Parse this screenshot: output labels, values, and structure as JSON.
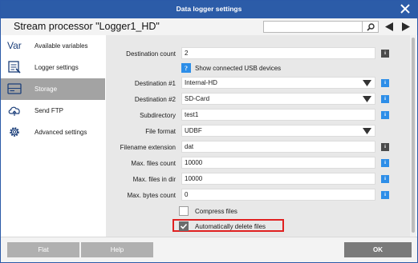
{
  "window": {
    "title": "Data logger settings"
  },
  "header": {
    "processor_title": "Stream processor \"Logger1_HD\"",
    "search_value": ""
  },
  "sidebar": {
    "items": [
      {
        "icon_text": "Var",
        "label": "Available variables",
        "active": false
      },
      {
        "label": "Logger settings",
        "active": false
      },
      {
        "label": "Storage",
        "active": true
      },
      {
        "label": "Send FTP",
        "active": false
      },
      {
        "label": "Advanced settings",
        "active": false
      }
    ]
  },
  "form": {
    "destination_count": {
      "label": "Destination count",
      "value": "2"
    },
    "show_usb": {
      "label": "Show connected USB devices",
      "icon_text": "?"
    },
    "destination1": {
      "label": "Destination #1",
      "value": "Internal-HD"
    },
    "destination2": {
      "label": "Destination #2",
      "value": "SD-Card"
    },
    "subdirectory": {
      "label": "Subdirectory",
      "value": "test1"
    },
    "file_format": {
      "label": "File format",
      "value": "UDBF"
    },
    "filename_extension": {
      "label": "Filename extension",
      "value": "dat"
    },
    "max_files_count": {
      "label": "Max. files count",
      "value": "10000"
    },
    "max_files_in_dir": {
      "label": "Max. files in dir",
      "value": "10000"
    },
    "max_bytes_count": {
      "label": "Max. bytes count",
      "value": "0"
    },
    "compress_files": {
      "label": "Compress files",
      "checked": false
    },
    "auto_delete": {
      "label": "Automatically delete files",
      "checked": true
    },
    "info_badge_text": "i"
  },
  "footer": {
    "flat_label": "Flat",
    "help_label": "Help",
    "ok_label": "OK"
  },
  "colors": {
    "titlebar": "#2c5ca8",
    "active_item": "#a3a3a3",
    "info_blue": "#2d8ee8",
    "info_dark": "#4a4a4a",
    "highlight": "#e02020"
  }
}
